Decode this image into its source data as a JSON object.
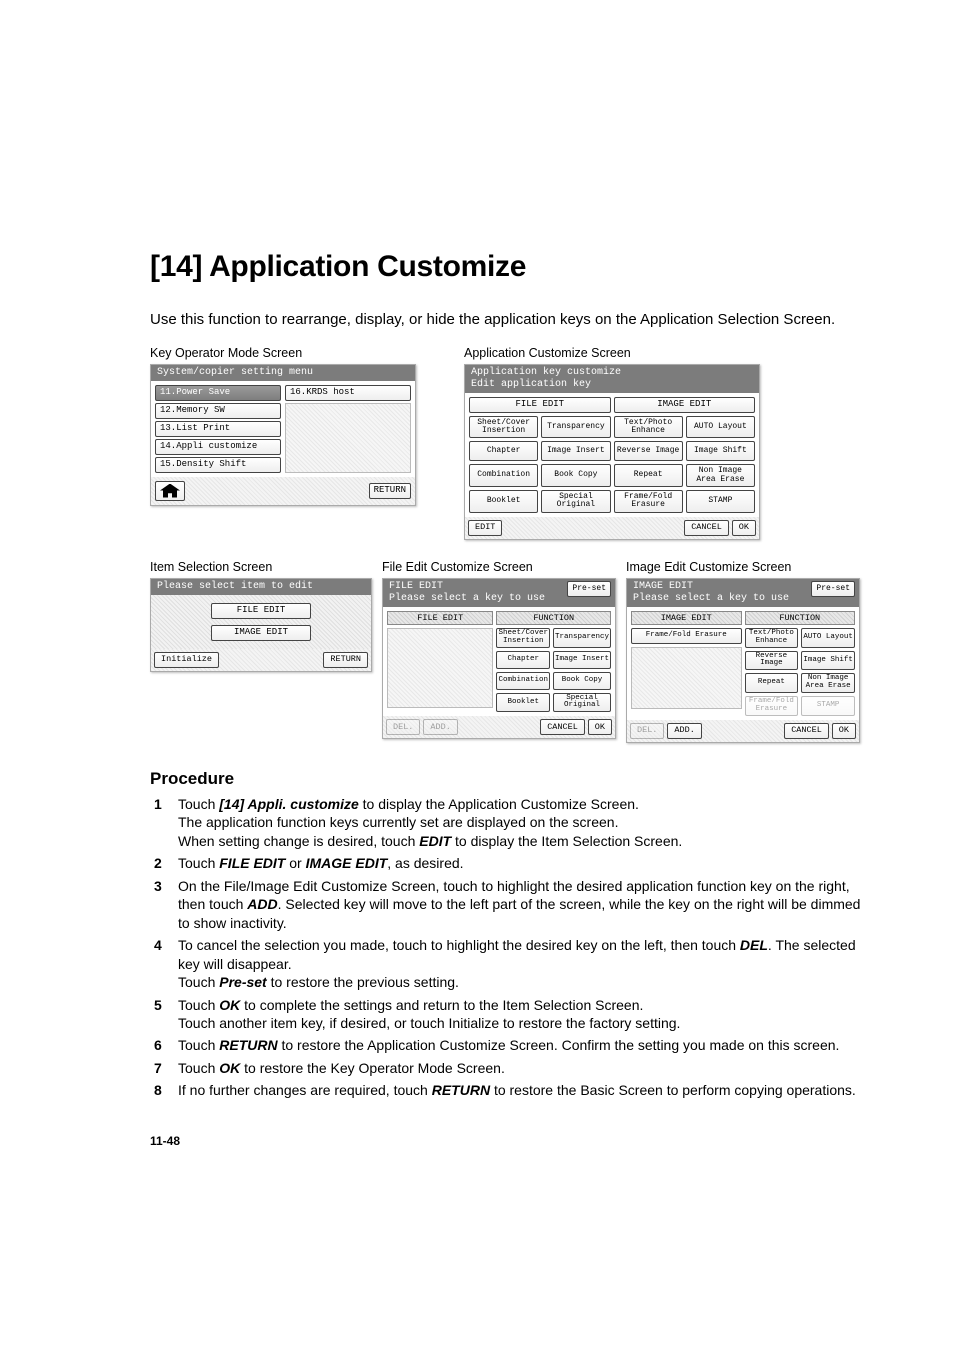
{
  "heading": "[14] Application Customize",
  "intro": "Use this function to rearrange, display, or hide the application keys on the Application Selection Screen.",
  "captions": {
    "key_operator": "Key Operator Mode Screen",
    "app_customize": "Application Customize Screen",
    "item_selection": "Item Selection Screen",
    "file_edit": "File Edit Customize Screen",
    "image_edit": "Image Edit Customize Screen"
  },
  "keyop": {
    "title": "System/copier setting menu",
    "left": [
      "11.Power Save",
      "12.Memory SW",
      "13.List Print",
      "14.Appli customize",
      "15.Density Shift"
    ],
    "right_first": "16.KRDS host",
    "return_label": "RETURN"
  },
  "appc": {
    "title1": "Application key customize",
    "title2": "Edit application key",
    "file_edit": "FILE EDIT",
    "image_edit": "IMAGE EDIT",
    "keys": [
      "Sheet/Cover Insertion",
      "Transparency",
      "Text/Photo Enhance",
      "AUTO Layout",
      "Chapter",
      "Image Insert",
      "Reverse Image",
      "Image Shift",
      "Combination",
      "Book Copy",
      "Repeat",
      "Non Image Area Erase",
      "Booklet",
      "Special Original",
      "Frame/Fold Erasure",
      "STAMP"
    ],
    "edit": "EDIT",
    "cancel": "CANCEL",
    "ok": "OK"
  },
  "isel": {
    "title": "Please select item to edit",
    "file_edit": "FILE EDIT",
    "image_edit": "IMAGE EDIT",
    "initialize": "Initialize",
    "return_label": "RETURN"
  },
  "fedit": {
    "title1": "FILE EDIT",
    "title2": "Please select a key to use",
    "preset": "Pre-set",
    "left_head": "FILE EDIT",
    "right_head": "FUNCTION",
    "func": [
      "Sheet/Cover Insertion",
      "Transparency",
      "Chapter",
      "Image Insert",
      "Combination",
      "Book Copy",
      "Booklet",
      "Special Original"
    ],
    "del": "DEL.",
    "add": "ADD.",
    "cancel": "CANCEL",
    "ok": "OK"
  },
  "iedit": {
    "title1": "IMAGE EDIT",
    "title2": "Please select a key to use",
    "preset": "Pre-set",
    "left_head": "IMAGE EDIT",
    "right_head": "FUNCTION",
    "left_items": [
      "Frame/Fold Erasure"
    ],
    "func": [
      "Text/Photo Enhance",
      "AUTO Layout",
      "Reverse Image",
      "Image Shift",
      "Repeat",
      "Non Image Area Erase",
      "Frame/Fold Erasure",
      "STAMP"
    ],
    "del": "DEL.",
    "add": "ADD.",
    "cancel": "CANCEL",
    "ok": "OK"
  },
  "procedure_heading": "Procedure",
  "steps": [
    {
      "pre": "Touch ",
      "bi": "[14] Appli. customize",
      "post": " to display the Application Customize Screen.",
      "more": [
        "The application function keys currently set are displayed on the screen.",
        "When setting change is desired, touch <b><i>EDIT</i></b> to display the Item Selection Screen."
      ]
    },
    {
      "raw": "Touch <b><i>FILE EDIT</i></b> or <b><i>IMAGE EDIT</i></b>, as desired."
    },
    {
      "raw": "On the File/Image Edit Customize Screen, touch to highlight the desired application function key on the right, then touch <b><i>ADD</i></b>. Selected key will move to the left part of the screen, while the key on the right will be dimmed to show inactivity."
    },
    {
      "raw": "To cancel the selection you made, touch to highlight the desired key on the left, then touch <b><i>DEL</i></b>. The selected key will disappear.",
      "more": [
        "Touch <b><i>Pre-set</i></b> to restore the previous setting."
      ]
    },
    {
      "raw": "Touch <b><i>OK</i></b> to complete the settings and return to the Item Selection Screen.",
      "more": [
        "Touch another item key, if desired, or touch Initialize to restore the factory setting."
      ]
    },
    {
      "raw": "Touch <b><i>RETURN</i></b> to restore the Application Customize Screen. Confirm the setting you made on this screen."
    },
    {
      "raw": "Touch <b><i>OK</i></b> to restore the Key Operator Mode Screen."
    },
    {
      "raw": "If no further changes are required, touch <b><i>RETURN</i></b> to restore the Basic Screen to perform copying operations."
    }
  ],
  "page_number": "11-48"
}
